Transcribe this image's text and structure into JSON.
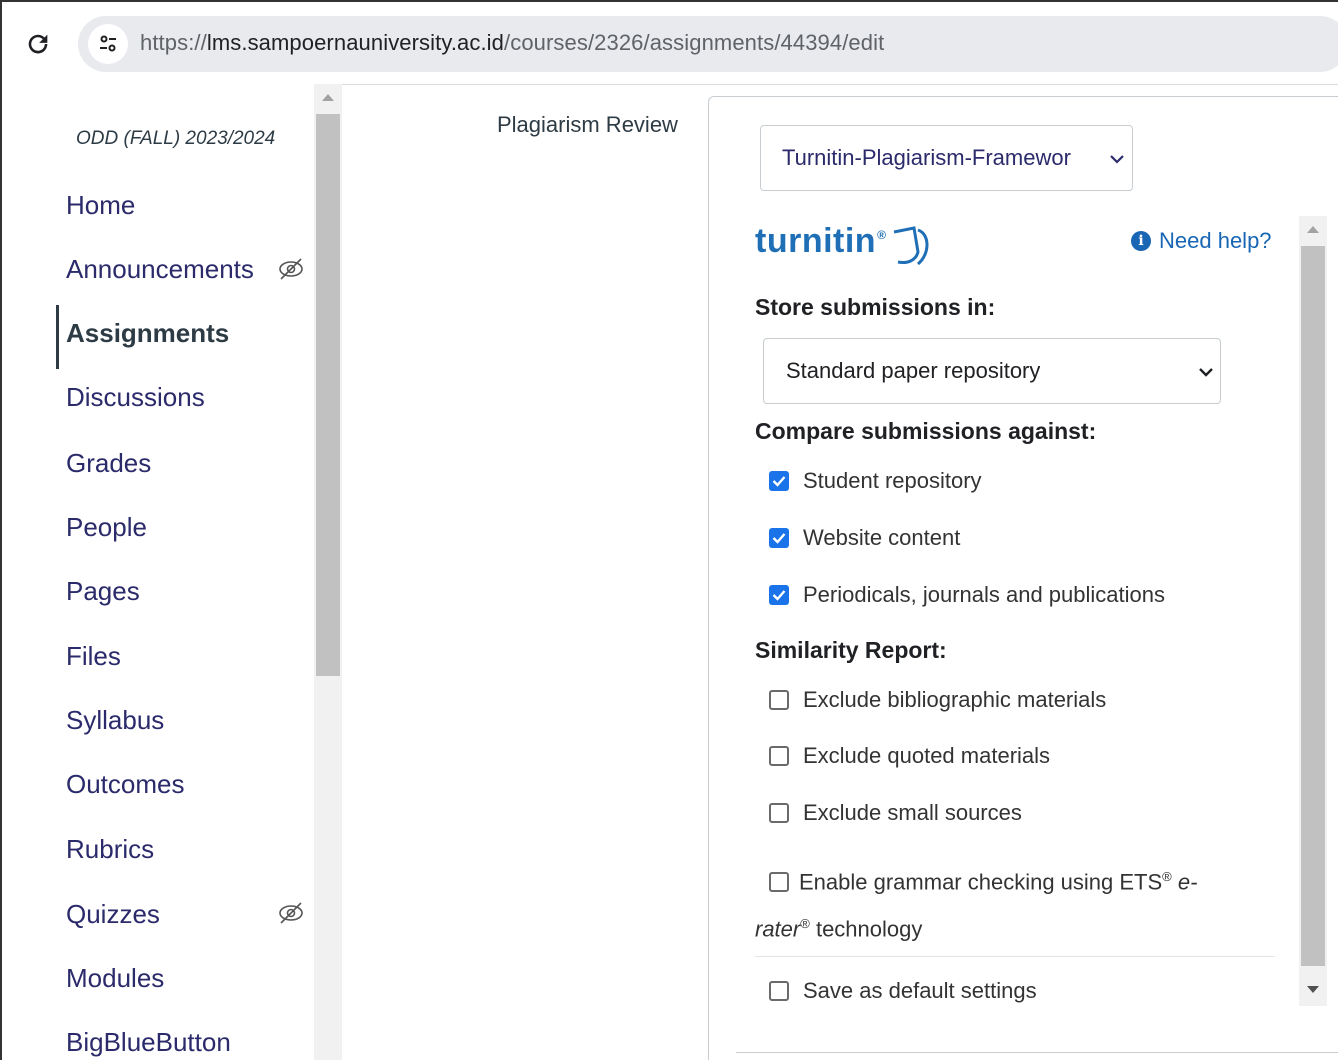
{
  "browser": {
    "url_prefix": "https://",
    "url_host": "lms.sampoernauniversity.ac.id",
    "url_path": "/courses/2326/assignments/44394/edit"
  },
  "sidebar": {
    "term": "ODD (FALL) 2023/2024",
    "items": [
      {
        "label": "Home"
      },
      {
        "label": "Announcements",
        "hidden_icon": "eye-slash-icon"
      },
      {
        "label": "Assignments",
        "active": true
      },
      {
        "label": "Discussions"
      },
      {
        "label": "Grades"
      },
      {
        "label": "People"
      },
      {
        "label": "Pages"
      },
      {
        "label": "Files"
      },
      {
        "label": "Syllabus"
      },
      {
        "label": "Outcomes"
      },
      {
        "label": "Rubrics"
      },
      {
        "label": "Quizzes",
        "hidden_icon": "eye-slash-icon"
      },
      {
        "label": "Modules"
      },
      {
        "label": "BigBlueButton"
      }
    ]
  },
  "form": {
    "field_label": "Plagiarism Review",
    "framework_select": "Turnitin-Plagiarism-Framewor"
  },
  "turnitin": {
    "logo_text": "turnitin",
    "logo_mark": "®",
    "help_label": "Need help?",
    "store_heading": "Store submissions in:",
    "repository_select": "Standard paper repository",
    "compare_heading": "Compare submissions against:",
    "compare_options": [
      {
        "label": "Student repository",
        "checked": true
      },
      {
        "label": "Website content",
        "checked": true
      },
      {
        "label": "Periodicals, journals and publications",
        "checked": true
      }
    ],
    "similarity_heading": "Similarity Report:",
    "similarity_options": [
      {
        "label": "Exclude bibliographic materials",
        "checked": false
      },
      {
        "label": "Exclude quoted materials",
        "checked": false
      },
      {
        "label": "Exclude small sources",
        "checked": false
      }
    ],
    "grammar_part1": "Enable grammar checking using ETS",
    "grammar_reg": "®",
    "grammar_erater_em1": "e-",
    "grammar_erater_em2": "rater",
    "grammar_part2": " technology",
    "save_default": "Save as default settings"
  },
  "colors": {
    "nav_link": "#2b2a6b",
    "turnitin_blue": "#1f6fb7",
    "checkbox_blue": "#1a73e8"
  }
}
